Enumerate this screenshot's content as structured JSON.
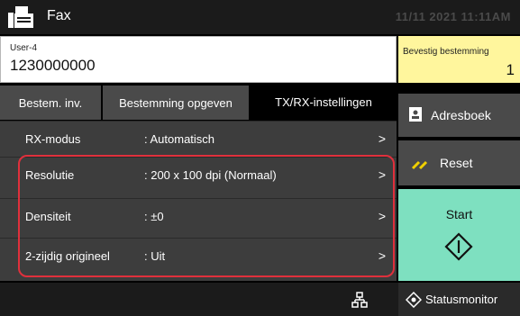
{
  "header": {
    "title": "Fax",
    "datetime": "11/11 2021 11:11AM",
    "icon": "fax-icon"
  },
  "destination": {
    "user": "User-4",
    "number": "1230000000"
  },
  "confirm_destination": {
    "label": "Bevestig bestemming",
    "count": "1"
  },
  "tabs": [
    {
      "label": "Bestem. inv.",
      "active": false
    },
    {
      "label": "Bestemming opgeven",
      "active": false
    },
    {
      "label": "TX/RX-instellingen",
      "active": true
    }
  ],
  "settings": [
    {
      "label": "RX-modus",
      "value": ":  Automatisch"
    },
    {
      "label": "Resolutie",
      "value": ":  200 x 100 dpi (Normaal)"
    },
    {
      "label": "Densiteit",
      "value": ":  ±0"
    },
    {
      "label": "2-zijdig origineel",
      "value": ":  Uit"
    }
  ],
  "chevron": ">",
  "side_buttons": {
    "address_book": "Adresboek",
    "reset": "Reset",
    "start": "Start"
  },
  "footer": {
    "status_monitor": "Statusmonitor"
  },
  "colors": {
    "start_bg": "#7ee0c0",
    "confirm_bg": "#fff69d",
    "highlight": "#e0303c"
  }
}
